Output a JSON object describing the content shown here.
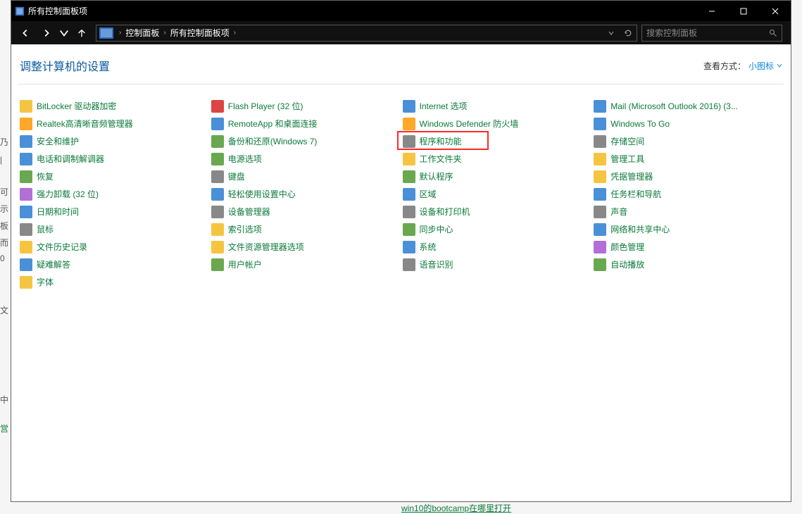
{
  "titlebar": {
    "title": "所有控制面板项"
  },
  "nav": {
    "crumb1": "控制面板",
    "crumb2": "所有控制面板项",
    "search_placeholder": "搜索控制面板"
  },
  "header": {
    "title": "调整计算机的设置",
    "view_label": "查看方式：",
    "view_value": "小图标"
  },
  "highlight_index": 2,
  "columns": [
    [
      {
        "label": "BitLocker 驱动器加密",
        "icon": "bitlocker-icon",
        "cls": "ic-a"
      },
      {
        "label": "Realtek高清晰音频管理器",
        "icon": "realtek-icon",
        "cls": "ic-g"
      },
      {
        "label": "安全和维护",
        "icon": "security-flag-icon",
        "cls": "ic-c"
      },
      {
        "label": "电话和调制解调器",
        "icon": "phone-modem-icon",
        "cls": "ic-c"
      },
      {
        "label": "恢复",
        "icon": "recovery-icon",
        "cls": "ic-d"
      },
      {
        "label": "强力卸载 (32 位)",
        "icon": "uninstall-icon",
        "cls": "ic-f"
      },
      {
        "label": "日期和时间",
        "icon": "date-time-icon",
        "cls": "ic-c"
      },
      {
        "label": "鼠标",
        "icon": "mouse-icon",
        "cls": "ic-e"
      },
      {
        "label": "文件历史记录",
        "icon": "file-history-icon",
        "cls": "ic-a"
      },
      {
        "label": "疑难解答",
        "icon": "troubleshoot-icon",
        "cls": "ic-c"
      },
      {
        "label": "字体",
        "icon": "fonts-icon",
        "cls": "ic-a"
      }
    ],
    [
      {
        "label": "Flash Player (32 位)",
        "icon": "flash-icon",
        "cls": "ic-b"
      },
      {
        "label": "RemoteApp 和桌面连接",
        "icon": "remoteapp-icon",
        "cls": "ic-c"
      },
      {
        "label": "备份和还原(Windows 7)",
        "icon": "backup-restore-icon",
        "cls": "ic-d"
      },
      {
        "label": "电源选项",
        "icon": "power-options-icon",
        "cls": "ic-d"
      },
      {
        "label": "键盘",
        "icon": "keyboard-icon",
        "cls": "ic-e"
      },
      {
        "label": "轻松使用设置中心",
        "icon": "ease-of-access-icon",
        "cls": "ic-c"
      },
      {
        "label": "设备管理器",
        "icon": "device-manager-icon",
        "cls": "ic-e"
      },
      {
        "label": "索引选项",
        "icon": "indexing-icon",
        "cls": "ic-a"
      },
      {
        "label": "文件资源管理器选项",
        "icon": "explorer-options-icon",
        "cls": "ic-a"
      },
      {
        "label": "用户帐户",
        "icon": "user-accounts-icon",
        "cls": "ic-d"
      }
    ],
    [
      {
        "label": "Internet 选项",
        "icon": "internet-options-icon",
        "cls": "ic-c"
      },
      {
        "label": "Windows Defender 防火墙",
        "icon": "defender-firewall-icon",
        "cls": "ic-g"
      },
      {
        "label": "程序和功能",
        "icon": "programs-features-icon",
        "cls": "ic-e"
      },
      {
        "label": "工作文件夹",
        "icon": "work-folders-icon",
        "cls": "ic-a"
      },
      {
        "label": "默认程序",
        "icon": "default-programs-icon",
        "cls": "ic-d"
      },
      {
        "label": "区域",
        "icon": "region-icon",
        "cls": "ic-c"
      },
      {
        "label": "设备和打印机",
        "icon": "devices-printers-icon",
        "cls": "ic-e"
      },
      {
        "label": "同步中心",
        "icon": "sync-center-icon",
        "cls": "ic-d"
      },
      {
        "label": "系统",
        "icon": "system-icon",
        "cls": "ic-c"
      },
      {
        "label": "语音识别",
        "icon": "speech-icon",
        "cls": "ic-e"
      }
    ],
    [
      {
        "label": "Mail (Microsoft Outlook 2016) (3...",
        "icon": "mail-icon",
        "cls": "ic-c"
      },
      {
        "label": "Windows To Go",
        "icon": "windows-to-go-icon",
        "cls": "ic-c"
      },
      {
        "label": "存储空间",
        "icon": "storage-spaces-icon",
        "cls": "ic-e"
      },
      {
        "label": "管理工具",
        "icon": "admin-tools-icon",
        "cls": "ic-a"
      },
      {
        "label": "凭据管理器",
        "icon": "credential-manager-icon",
        "cls": "ic-a"
      },
      {
        "label": "任务栏和导航",
        "icon": "taskbar-nav-icon",
        "cls": "ic-c"
      },
      {
        "label": "声音",
        "icon": "sound-icon",
        "cls": "ic-e"
      },
      {
        "label": "网络和共享中心",
        "icon": "network-sharing-icon",
        "cls": "ic-c"
      },
      {
        "label": "颜色管理",
        "icon": "color-mgmt-icon",
        "cls": "ic-f"
      },
      {
        "label": "自动播放",
        "icon": "autoplay-icon",
        "cls": "ic-d"
      }
    ]
  ],
  "bg": {
    "bottom_link": "win10的bootcamp在哪里打开"
  }
}
